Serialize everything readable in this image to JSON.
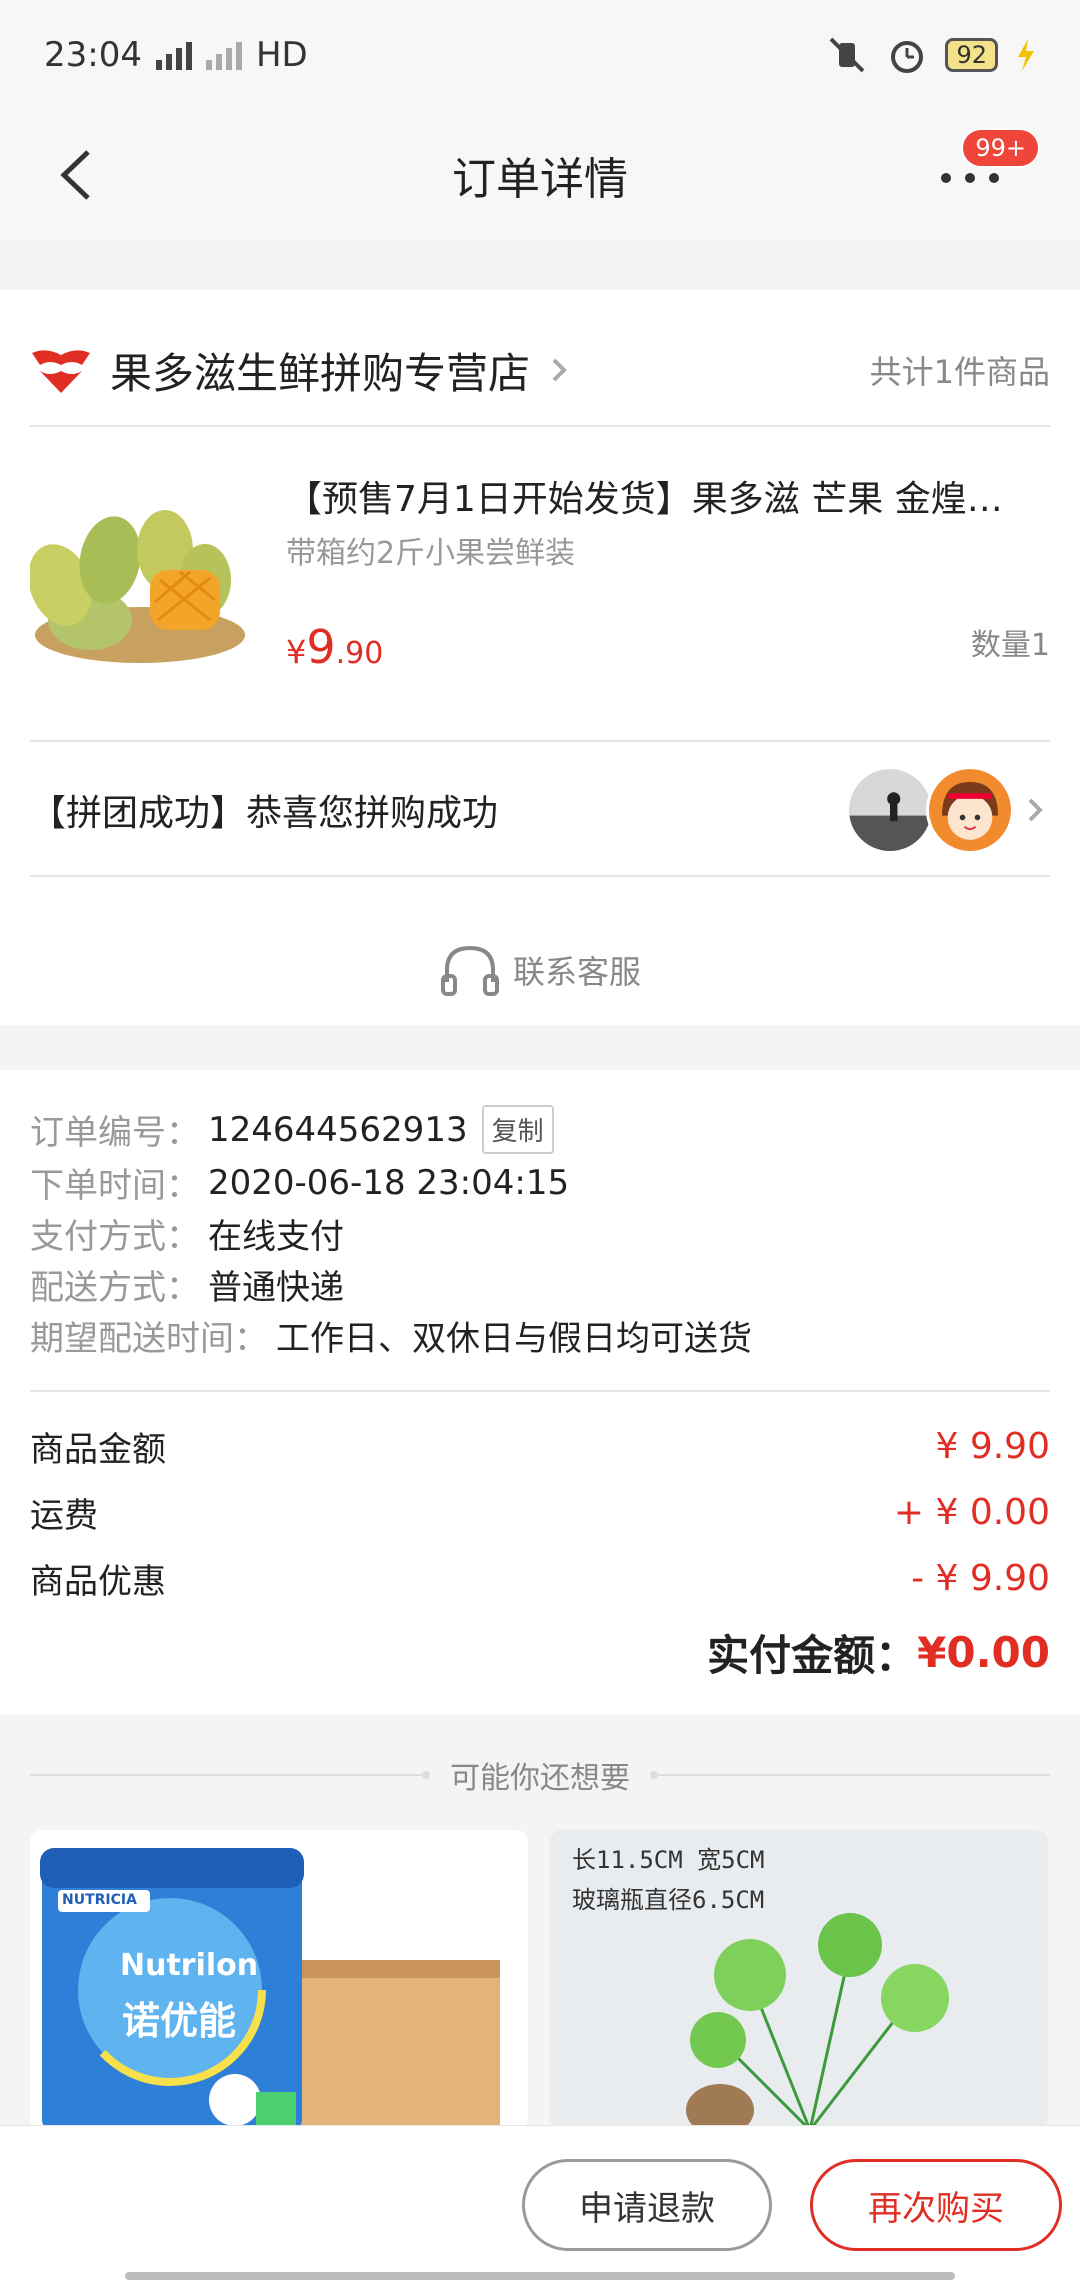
{
  "status_bar": {
    "time": "23:04",
    "network": "HD",
    "battery": "92"
  },
  "nav": {
    "title": "订单详情",
    "badge": "99+"
  },
  "store": {
    "name": "果多滋生鲜拼购专营店",
    "count": "共计1件商品"
  },
  "product": {
    "title": "【预售7月1日开始发货】果多滋 芒果 金煌…",
    "subtitle": "带箱约2斤小果尝鲜装",
    "price_symbol": "¥",
    "price_int": "9",
    "price_dec": ".90",
    "quantity": "数量1"
  },
  "group": {
    "text": "【拼团成功】恭喜您拼购成功"
  },
  "service": {
    "label": "联系客服"
  },
  "order_info": {
    "order_no_label": "订单编号：",
    "order_no": "124644562913",
    "copy_label": "复制",
    "time_label": "下单时间：",
    "time": "2020-06-18 23:04:15",
    "pay_label": "支付方式：",
    "pay": "在线支付",
    "ship_label": "配送方式：",
    "ship": "普通快递",
    "expect_label": "期望配送时间：",
    "expect": "工作日、双休日与假日均可送货"
  },
  "fees": {
    "goods_label": "商品金额",
    "goods_val": "¥ 9.90",
    "freight_label": "运费",
    "freight_val": "+ ¥ 0.00",
    "discount_label": "商品优惠",
    "discount_val": "- ¥ 9.90",
    "total_label": "实付金额：",
    "total_val": "¥0.00"
  },
  "recommend": {
    "title": "可能你还想要",
    "left_brand": "Nutrilon",
    "left_brand_cn": "诺优能",
    "left_maker": "NUTRICIA",
    "right_line1": "长11.5CM 宽5CM",
    "right_line2": "玻璃瓶直径6.5CM"
  },
  "bottom": {
    "refund_label": "申请退款",
    "rebuy_label": "再次购买"
  }
}
